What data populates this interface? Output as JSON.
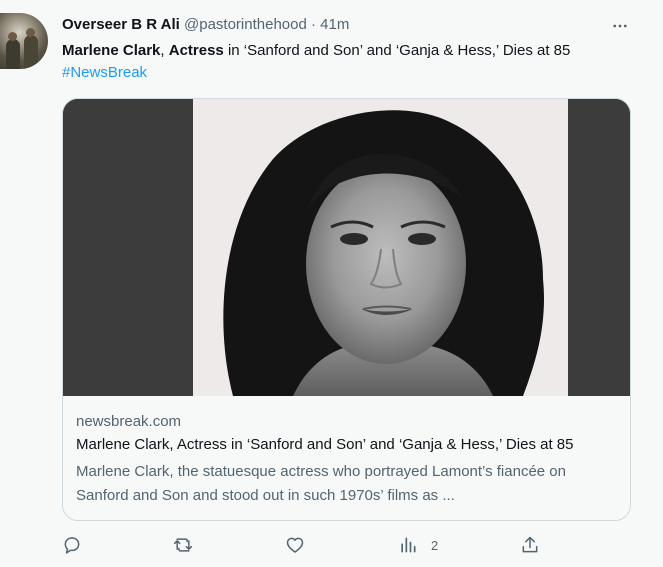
{
  "author": {
    "name": "Overseer B R Ali",
    "handle": "@pastorinthehood",
    "separator": "·",
    "time": "41m"
  },
  "tweet": {
    "text_bold_1": "Marlene Clark",
    "text_comma": ", ",
    "text_bold_2": "Actress",
    "text_rest": " in ‘Sanford and Son’ and ‘Ganja & Hess,’ Dies at 85 ",
    "hashtag": "#NewsBreak"
  },
  "card": {
    "domain": "newsbreak.com",
    "title": "Marlene Clark, Actress in ‘Sanford and Son’ and ‘Ganja & Hess,’ Dies at 85",
    "description": "Marlene Clark, the statuesque actress who portrayed Lamont’s fiancée on Sanford and Son and stood out in such 1970s’ films as ...",
    "image_icon": "portrait-photo"
  },
  "actions": {
    "reply_icon": "reply-icon",
    "retweet_icon": "retweet-icon",
    "like_icon": "heart-icon",
    "views_icon": "views-icon",
    "views_count": "2",
    "share_icon": "share-icon"
  },
  "colors": {
    "accent": "#1d9bf0",
    "secondary_text": "#536471",
    "border": "#cfd9de",
    "background": "#f7f9f9"
  }
}
